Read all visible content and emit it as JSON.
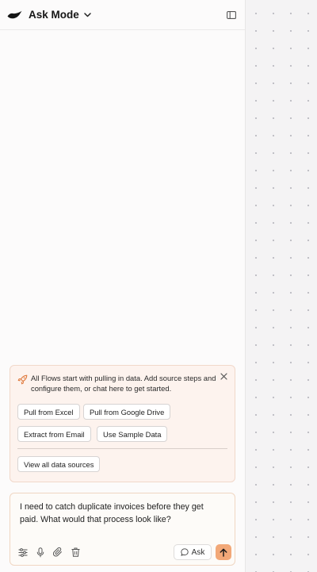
{
  "header": {
    "mode_title": "Ask Mode",
    "logo_icon": "brand-logo-icon",
    "mode_dropdown_icon": "chevron-down-icon",
    "sidebar_toggle_icon": "sidebar-toggle-icon"
  },
  "onboarding": {
    "icon": "rocket-icon",
    "message": "All Flows start with pulling in data. Add source steps and configure them, or chat here to get started.",
    "close_icon": "close-icon",
    "sources": [
      {
        "label": "Pull from Excel"
      },
      {
        "label": "Pull from Google Drive"
      },
      {
        "label": "Extract from Email"
      },
      {
        "label": "Use Sample Data"
      }
    ],
    "view_all_label": "View all data sources"
  },
  "composer": {
    "text": "I need to catch duplicate invoices before they get paid. What would that process look like?",
    "tools": [
      "settings-sliders-icon",
      "microphone-icon",
      "paperclip-icon",
      "trash-icon"
    ],
    "ask_label": "Ask",
    "ask_icon": "chat-bubble-icon",
    "send_icon": "arrow-up-icon"
  },
  "colors": {
    "accent": "#f2a878",
    "card_background": "#fdf3ee",
    "canvas_background": "#f4f3f4"
  }
}
